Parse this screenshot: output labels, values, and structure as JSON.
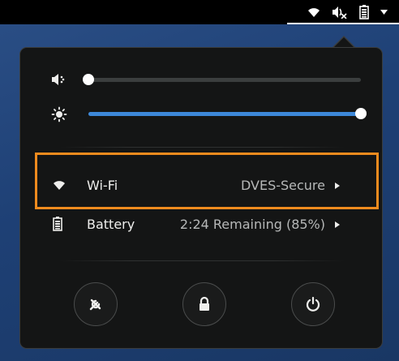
{
  "topbar": {
    "indicators": [
      {
        "name": "wifi-icon"
      },
      {
        "name": "volume-muted-icon"
      },
      {
        "name": "battery-icon"
      },
      {
        "name": "dropdown-arrow-icon"
      }
    ]
  },
  "menu": {
    "volume": {
      "icon": "volume-icon",
      "level": 0.0
    },
    "brightness": {
      "icon": "brightness-icon",
      "level": 1.0
    },
    "wifi": {
      "icon": "wifi-icon",
      "label": "Wi-Fi",
      "value": "DVES-Secure"
    },
    "battery": {
      "icon": "battery-icon",
      "label": "Battery",
      "value": "2:24 Remaining (85%)"
    },
    "actions": [
      {
        "name": "settings-button",
        "icon": "settings-icon"
      },
      {
        "name": "lock-button",
        "icon": "lock-icon"
      },
      {
        "name": "power-button",
        "icon": "power-icon"
      }
    ]
  },
  "colors": {
    "accent": "#3d88d8",
    "highlight": "#f08b1e",
    "menu_bg": "#141515",
    "desktop_bg": "#1e4075"
  }
}
